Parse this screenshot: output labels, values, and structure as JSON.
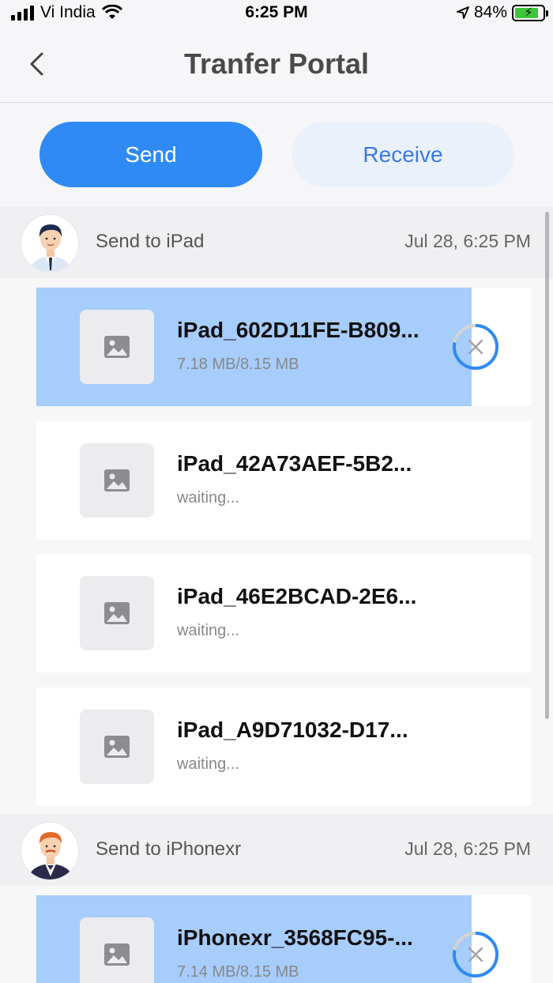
{
  "status_bar": {
    "carrier": "Vi India",
    "time": "6:25 PM",
    "battery": "84%"
  },
  "nav": {
    "title": "Tranfer Portal"
  },
  "tabs": {
    "send": "Send",
    "receive": "Receive"
  },
  "groups": [
    {
      "label": "Send to iPad",
      "time": "Jul 28, 6:25 PM",
      "files": [
        {
          "name": "iPad_602D11FE-B809...",
          "status": "7.18 MB/8.15 MB",
          "progress": 0.88
        },
        {
          "name": "iPad_42A73AEF-5B2...",
          "status": "waiting..."
        },
        {
          "name": "iPad_46E2BCAD-2E6...",
          "status": "waiting..."
        },
        {
          "name": "iPad_A9D71032-D17...",
          "status": "waiting..."
        }
      ]
    },
    {
      "label": "Send to iPhonexr",
      "time": "Jul 28, 6:25 PM",
      "files": [
        {
          "name": "iPhonexr_3568FC95-...",
          "status": "7.14 MB/8.15 MB",
          "progress": 0.88
        }
      ]
    }
  ],
  "colors": {
    "accent": "#2f8af5",
    "progress": "#a6cdfb"
  }
}
